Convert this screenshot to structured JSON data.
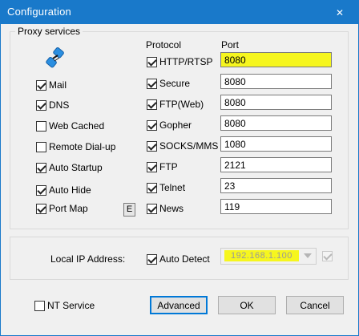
{
  "window": {
    "title": "Configuration",
    "close_glyph": "✕"
  },
  "proxy_services": {
    "legend": "Proxy services",
    "icon": "network-connection-icon",
    "services": [
      {
        "label": "Mail",
        "checked": true
      },
      {
        "label": "DNS",
        "checked": true
      },
      {
        "label": "Web Cached",
        "checked": false
      },
      {
        "label": "Remote Dial-up",
        "checked": false
      },
      {
        "label": "Auto Startup",
        "checked": true
      },
      {
        "label": "Auto Hide",
        "checked": true
      },
      {
        "label": "Port Map",
        "checked": true
      }
    ],
    "port_map_edit_label": "E",
    "protocol_header": "Protocol",
    "port_header": "Port",
    "protocols": [
      {
        "label": "HTTP/RTSP",
        "checked": true,
        "port": "8080",
        "highlighted": true
      },
      {
        "label": "Secure",
        "checked": true,
        "port": "8080",
        "highlighted": false
      },
      {
        "label": "FTP(Web)",
        "checked": true,
        "port": "8080",
        "highlighted": false
      },
      {
        "label": "Gopher",
        "checked": true,
        "port": "8080",
        "highlighted": false
      },
      {
        "label": "SOCKS/MMS",
        "checked": true,
        "port": "1080",
        "highlighted": false
      },
      {
        "label": "FTP",
        "checked": true,
        "port": "2121",
        "highlighted": false
      },
      {
        "label": "Telnet",
        "checked": true,
        "port": "23",
        "highlighted": false
      },
      {
        "label": "News",
        "checked": true,
        "port": "119",
        "highlighted": false
      }
    ]
  },
  "local_ip": {
    "label": "Local IP Address:",
    "auto_detect_label": "Auto Detect",
    "auto_detect_checked": true,
    "address": "192.168.1.100",
    "confirm_checked": true
  },
  "footer": {
    "nt_service_label": "NT Service",
    "nt_service_checked": false,
    "advanced_label": "Advanced",
    "ok_label": "OK",
    "cancel_label": "Cancel"
  }
}
